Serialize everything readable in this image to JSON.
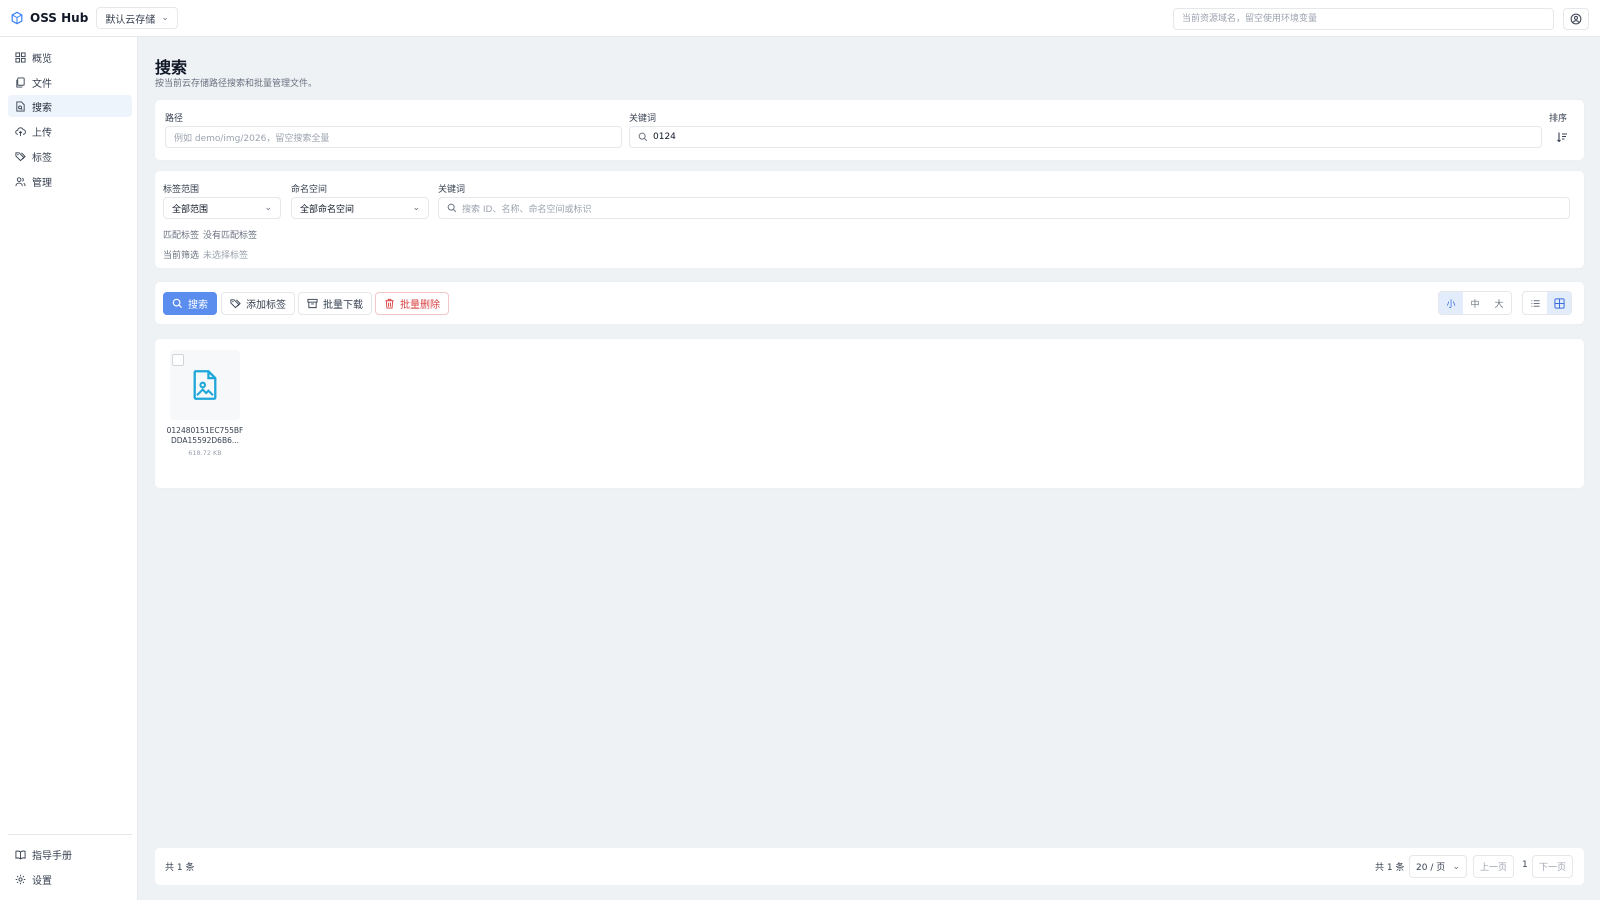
{
  "header": {
    "brand": "OSS Hub",
    "bucket": "默认云存储",
    "domain_placeholder": "当前资源域名，留空使用环境变量"
  },
  "sidebar": {
    "items": [
      {
        "label": "概览",
        "icon": "dashboard-icon"
      },
      {
        "label": "文件",
        "icon": "files-icon"
      },
      {
        "label": "搜索",
        "icon": "search-file-icon",
        "active": true
      },
      {
        "label": "上传",
        "icon": "upload-cloud-icon"
      },
      {
        "label": "标签",
        "icon": "tags-icon"
      },
      {
        "label": "管理",
        "icon": "users-icon"
      }
    ],
    "bottom": [
      {
        "label": "指导手册",
        "icon": "book-icon"
      },
      {
        "label": "设置",
        "icon": "gear-icon"
      }
    ]
  },
  "page": {
    "title": "搜索",
    "subtitle": "按当前云存储路径搜索和批量管理文件。"
  },
  "search": {
    "path_label": "路径",
    "path_placeholder": "例如 demo/img/2026，留空搜索全量",
    "keyword_label": "关键词",
    "keyword_value": "0124",
    "sort_label": "排序"
  },
  "tags": {
    "scope_label": "标签范围",
    "scope_value": "全部范围",
    "namespace_label": "命名空间",
    "namespace_value": "全部命名空间",
    "keyword_label": "关键词",
    "keyword_placeholder": "搜索 ID、名称、命名空间或标识",
    "match": "匹配标签",
    "no_match": "没有匹配标签",
    "current_label": "当前筛选",
    "current_value": "未选择标签"
  },
  "toolbar": {
    "search": "搜索",
    "add_tag": "添加标签",
    "batch_download": "批量下载",
    "batch_delete": "批量删除",
    "size_small": "小",
    "size_medium": "中",
    "size_large": "大"
  },
  "files": [
    {
      "name": "012480151EC755BFDDA15592D6B6...",
      "size": "618.72 KB"
    }
  ],
  "footer": {
    "total_left": "共 1 条",
    "total_right": "共 1 条",
    "page_size": "20 / 页",
    "prev": "上一页",
    "page": "1",
    "next": "下一页"
  },
  "colors": {
    "accent": "#5b8def",
    "danger": "#d94040",
    "file_icon": "#1ea7d8"
  }
}
